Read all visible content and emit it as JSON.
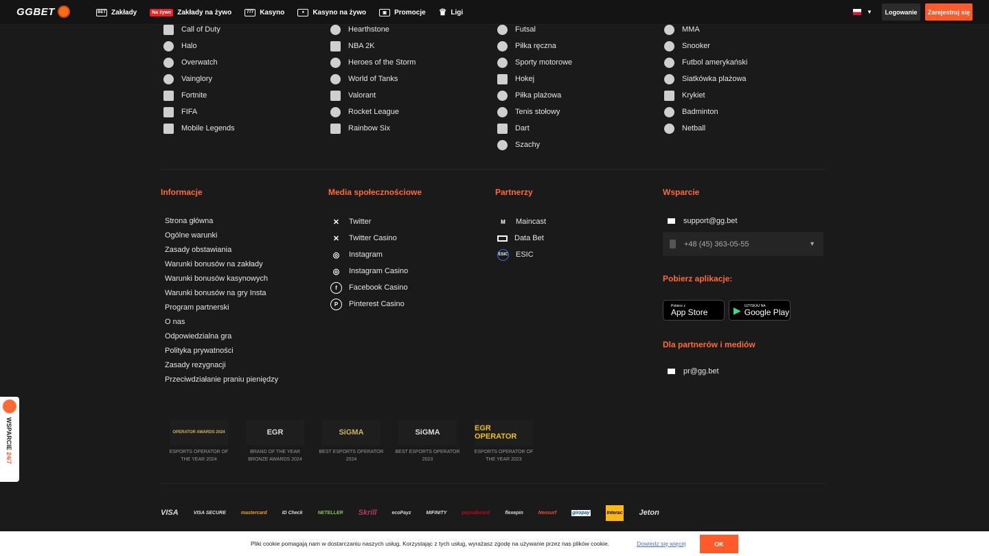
{
  "header": {
    "logo": "GGBET",
    "nav": [
      {
        "label": "Zakłady",
        "icon": "bet-icon"
      },
      {
        "badge": "Na żywo",
        "label": "Zakłady na żywo"
      },
      {
        "label": "Kasyno",
        "icon": "casino-icon"
      },
      {
        "label": "Kasyno na żywo",
        "icon": "live-casino-icon"
      },
      {
        "label": "Promocje",
        "icon": "gift-icon"
      },
      {
        "label": "Ligi",
        "icon": "crown-icon"
      }
    ],
    "login": "Logowanie",
    "register": "Zarejestruj się"
  },
  "games": {
    "col1": [
      "Call of Duty",
      "Halo",
      "Overwatch",
      "Vainglory",
      "Fortnite",
      "FIFA",
      "Mobile Legends"
    ],
    "col2": [
      "Hearthstone",
      "NBA 2K",
      "Heroes of the Storm",
      "World of Tanks",
      "Valorant",
      "Rocket League",
      "Rainbow Six"
    ],
    "col3": [
      "Futsal",
      "Piłka ręczna",
      "Sporty motorowe",
      "Hokej",
      "Piłka plażowa",
      "Tenis stołowy",
      "Dart",
      "Szachy"
    ],
    "col4": [
      "MMA",
      "Snooker",
      "Futbol amerykański",
      "Siatkówka plażowa",
      "Krykiet",
      "Badminton",
      "Netball"
    ]
  },
  "info": {
    "title": "Informacje",
    "links": [
      "Strona główna",
      "Ogólne warunki",
      "Zasady obstawiania",
      "Warunki bonusów na zakłady",
      "Warunki bonusów kasynowych",
      "Warunki bonusów na gry Insta",
      "Program partnerski",
      "O nas",
      "Odpowiedzialna gra",
      "Polityka prywatności",
      "Zasady rezygnacji",
      "Przeciwdziałanie praniu pieniędzy"
    ]
  },
  "social": {
    "title": "Media społecznościowe",
    "links": [
      {
        "label": "Twitter",
        "glyph": "✕"
      },
      {
        "label": "Twitter Casino",
        "glyph": "✕"
      },
      {
        "label": "Instagram",
        "glyph": "◎"
      },
      {
        "label": "Instagram Casino",
        "glyph": "◎"
      },
      {
        "label": "Facebook Casino",
        "glyph": "f"
      },
      {
        "label": "Pinterest Casino",
        "glyph": "P"
      }
    ]
  },
  "partners": {
    "title": "Partnerzy",
    "links": [
      "Maincast",
      "Data Bet",
      "ESIC"
    ]
  },
  "support": {
    "title": "Wsparcie",
    "email": "support@gg.bet",
    "phone": "+48 (45) 363-05-55",
    "app_title": "Pobierz aplikacje:",
    "appstore_small": "Pobierz z",
    "appstore_big": "App Store",
    "gplay_small": "UZYSKAJ NA",
    "gplay_big": "Google Play",
    "pr_title": "Dla partnerów i mediów",
    "pr_email": "pr@gg.bet"
  },
  "awards": [
    {
      "logo": "OPERATOR AWARDS 2024",
      "caption": "ESPORTS OPERATOR OF THE YEAR 2024"
    },
    {
      "logo": "EGR",
      "caption": "BRAND OF THE YEAR BRONZE AWARDS 2024"
    },
    {
      "logo": "SiGMA",
      "caption": "BEST ESPORTS OPERATOR 2024"
    },
    {
      "logo": "SiGMA",
      "caption": "BEST ESPORTS OPERATOR 2023"
    },
    {
      "logo": "EGR OPERATOR",
      "caption": "ESPORTS OPERATOR OF THE YEAR 2023"
    }
  ],
  "payments": [
    "VISA",
    "VISA SECURE",
    "mastercard",
    "ID Check",
    "NETELLER",
    "Skrill",
    "ecoPayz",
    "MIFINITY",
    "paysafecard",
    "flexepin",
    "Neosurf",
    "giropay",
    "Interac",
    "Jeton"
  ],
  "cookie": {
    "text": "Pliki cookie pomagają nam w dostarczaniu naszych usług. Korzystając z tych usług, wyrażasz zgodę na używanie przez nas plików cookie.",
    "link": "Dowiedz się więcej",
    "ok": "OK"
  },
  "support_tab": {
    "label": "WSPARCIE",
    "hours": "24/7"
  }
}
